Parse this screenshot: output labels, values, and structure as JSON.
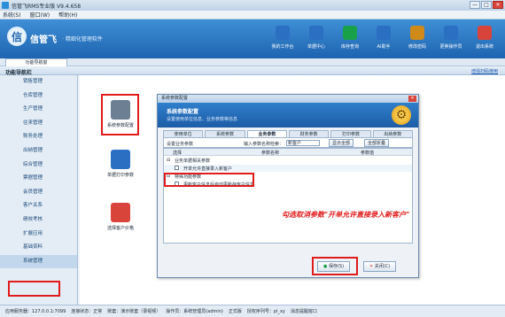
{
  "window": {
    "title": "信管飞RMS专业版 V9.4.658",
    "buttons": [
      "—",
      "□",
      "✕"
    ]
  },
  "menu": [
    "系统(S)",
    "窗口(W)",
    "帮助(H)"
  ],
  "brand": {
    "logo": "信管飞",
    "tagline": "· 精细化管理软件"
  },
  "toolbar": [
    {
      "label": "我的工作台",
      "color": "#2a6fc1"
    },
    {
      "label": "单据中心",
      "color": "#2a6fc1"
    },
    {
      "label": "库存查询",
      "color": "#19a14a"
    },
    {
      "label": "AI助手",
      "color": "#2a6fc1"
    },
    {
      "label": "修改密码",
      "color": "#d08a1a"
    },
    {
      "label": "更换操作员",
      "color": "#2a6fc1"
    },
    {
      "label": "退出系统",
      "color": "#d9443a"
    }
  ],
  "tab": "功能导航窗",
  "nav": {
    "title": "功能导航栏",
    "link": "增强扫码使用"
  },
  "sidebar": [
    "销售管理",
    "仓库管理",
    "生产管理",
    "往来管理",
    "账务处理",
    "出纳管理",
    "综合管理",
    "票据管理",
    "会员管理",
    "客户关系",
    "绩效考核",
    "扩展应用",
    "基础资料",
    "系统管理"
  ],
  "tiles": [
    {
      "label": "系统参数配置",
      "color": "#6d7f92"
    },
    {
      "label": "单据打印参数",
      "color": "#2a6fc1"
    },
    {
      "label": "选择客户价格",
      "color": "#d9443a"
    }
  ],
  "dialog": {
    "title": "系统参数配置",
    "header": "系统参数配置",
    "subheader": "设置使用单位信息、业务参数等信息",
    "tabs": [
      "使用单位",
      "系统参数",
      "业务参数",
      "财务参数",
      "打印参数",
      "出纳参数"
    ],
    "active_tab": 2,
    "search_label": "设置业务参数",
    "search_prompt": "输入参数名称检索：",
    "search_value": "新客户",
    "show_all": "显示全部",
    "collapse_all": "全部折叠",
    "columns": [
      "选择",
      "参数名称",
      "参数值"
    ],
    "groups": [
      {
        "name": "业务单据相关参数",
        "rows": [
          "开单允许直接录入新客户"
        ]
      },
      {
        "name": "特殊功能参数",
        "rows": [
          "更新客户信息后自动更新存客户信息"
        ]
      }
    ],
    "save": "保存(S)",
    "close": "关闭(C)"
  },
  "annotation": "勾选取消参数\"开单允许直接录入新客户\"",
  "status": [
    "应用服务器：127.0.0.1:7099",
    "连接状态：正常",
    "账套：演示账套（录视频）",
    "操作员：系统管理员(admin)",
    "正式版",
    "授权序列号：pl_xy",
    "消息提醒窗口"
  ]
}
